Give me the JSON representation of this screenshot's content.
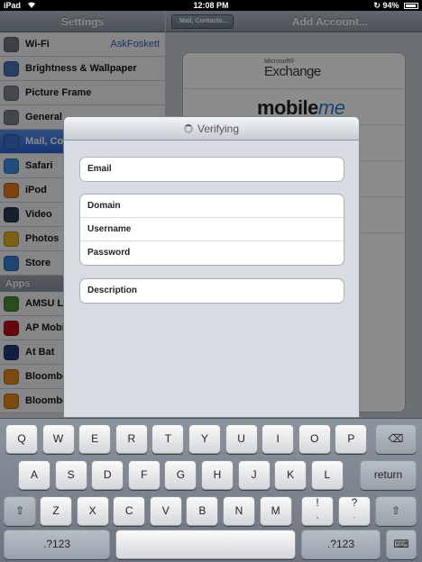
{
  "status": {
    "carrier": "iPad",
    "time": "12:08 PM",
    "battery": "94%",
    "battery_level": 0.94
  },
  "master": {
    "title": "Settings",
    "items": [
      {
        "label": "Wi-Fi",
        "value": "AskFoskett",
        "icon": "wifi-icon",
        "color": "#6e7681"
      },
      {
        "label": "Brightness & Wallpaper",
        "value": "",
        "icon": "brightness-icon",
        "color": "#4e6fb5"
      },
      {
        "label": "Picture Frame",
        "value": "",
        "icon": "picture-frame-icon",
        "color": "#7e8690"
      },
      {
        "label": "General",
        "value": "",
        "icon": "gear-icon",
        "color": "#7a828c"
      },
      {
        "label": "Mail, Co",
        "value": "",
        "icon": "mail-icon",
        "color": "#3f72c9",
        "selected": true
      },
      {
        "label": "Safari",
        "value": "",
        "icon": "compass-icon",
        "color": "#3e8fe0"
      },
      {
        "label": "iPod",
        "value": "",
        "icon": "music-icon",
        "color": "#e47a1e"
      },
      {
        "label": "Video",
        "value": "",
        "icon": "film-icon",
        "color": "#2b3a55"
      },
      {
        "label": "Photos",
        "value": "",
        "icon": "flower-icon",
        "color": "#e0b22a"
      },
      {
        "label": "Store",
        "value": "",
        "icon": "store-icon",
        "color": "#3a7cd0"
      }
    ],
    "apps_header": "Apps",
    "apps": [
      {
        "label": "AMSU L",
        "icon": "amsu-app-icon",
        "color": "#4c8a3a"
      },
      {
        "label": "AP Mobi",
        "icon": "ap-mobile-app-icon",
        "color": "#b8121a"
      },
      {
        "label": "At Bat",
        "icon": "at-bat-app-icon",
        "color": "#1f3a7a"
      },
      {
        "label": "Bloombe",
        "icon": "bloomberg-app-icon",
        "color": "#e08a1e"
      },
      {
        "label": "Bloombe",
        "icon": "bloomberg-app-icon",
        "color": "#e08a1e"
      }
    ]
  },
  "detail": {
    "back_label": "Mail, Contacts...",
    "title": "Add Account...",
    "providers": {
      "exchange_small": "Microsoft®",
      "exchange": "Exchange",
      "mobileme_a": "mobile",
      "mobileme_b": "me"
    }
  },
  "modal": {
    "title": "Verifying",
    "fields": [
      {
        "label": "Email",
        "value": ""
      },
      {
        "label": "Domain",
        "value": ""
      },
      {
        "label": "Username",
        "value": ""
      },
      {
        "label": "Password",
        "value": ""
      },
      {
        "label": "Description",
        "value": ""
      }
    ]
  },
  "keyboard": {
    "row1": [
      "Q",
      "W",
      "E",
      "R",
      "T",
      "Y",
      "U",
      "I",
      "O",
      "P"
    ],
    "row2": [
      "A",
      "S",
      "D",
      "F",
      "G",
      "H",
      "J",
      "K",
      "L"
    ],
    "row3": [
      "Z",
      "X",
      "C",
      "V",
      "B",
      "N",
      "M"
    ],
    "return": "return",
    "numbers": ".?123",
    "row3_extra": [
      "!",
      "?"
    ],
    "row3_extra_sub": [
      ",",
      "."
    ]
  }
}
